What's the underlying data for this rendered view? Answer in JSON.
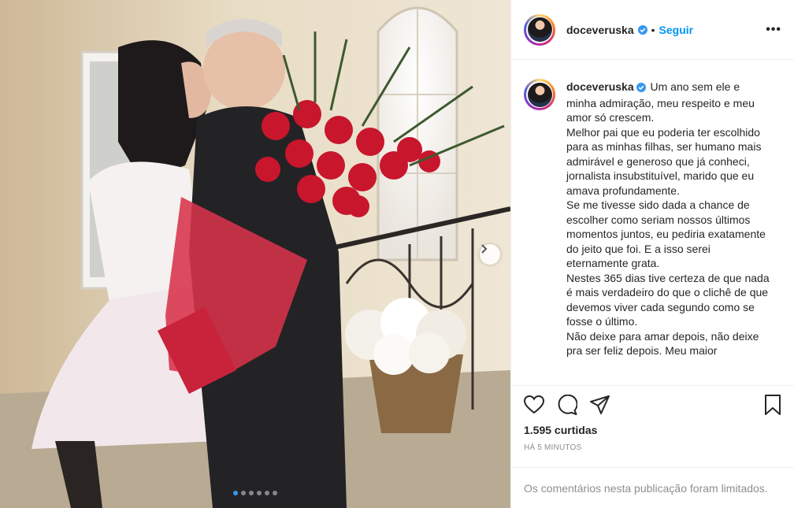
{
  "post": {
    "username": "doceveruska",
    "follow_label": "Seguir",
    "separator": "•",
    "more_label": "•••",
    "caption_text": " Um ano sem ele e minha admiração, meu respeito e meu amor só crescem.\nMelhor pai que eu poderia ter escolhido para as minhas filhas, ser humano mais admirável e generoso que já conheci, jornalista insubstituível, marido que eu amava profundamente.\nSe me tivesse sido dada a chance de escolher como seriam nossos últimos momentos juntos, eu pediria exatamente do jeito que foi. E a isso serei eternamente grata.\nNestes 365 dias tive certeza de que nada é mais verdadeiro do que o clichê de que devemos viver cada segundo como se fosse o último.\nNão deixe para amar depois, não deixe pra ser feliz depois. Meu maior",
    "likes": "1.595 curtidas",
    "timestamp": "HÁ 5 MINUTOS",
    "comments_limited": "Os comentários nesta publicação foram limitados.",
    "carousel": {
      "total": 6,
      "active_index": 0
    }
  },
  "icons": {
    "verified": "verified-badge-icon",
    "like": "heart-icon",
    "comment": "comment-icon",
    "share": "paper-plane-icon",
    "save": "bookmark-icon",
    "next": "chevron-right-icon"
  },
  "colors": {
    "link": "#0095f6",
    "verified": "#3897f0",
    "secondary_text": "#8e8e8e",
    "border": "#efefef"
  }
}
